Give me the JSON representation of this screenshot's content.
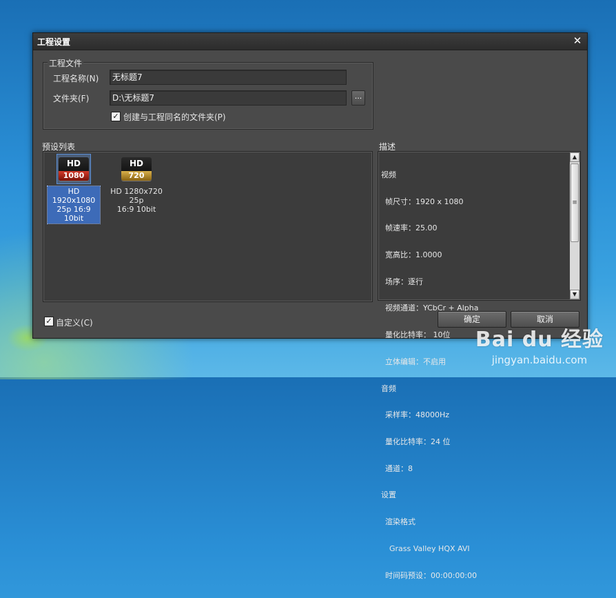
{
  "dialog": {
    "title": "工程设置",
    "close_glyph": "✕",
    "project_file_group": {
      "legend": "工程文件",
      "name_label": "工程名称(N)",
      "name_value": "无标题7",
      "folder_label": "文件夹(F)",
      "folder_value": "D:\\无标题7",
      "browse_label": "...",
      "create_folder_checkbox": {
        "checked": true,
        "label": "创建与工程同名的文件夹(P)"
      }
    },
    "preset_list": {
      "label": "预设列表",
      "presets": [
        {
          "icon": "hd-1080-icon",
          "badge_top": "HD",
          "badge_bottom": "1080",
          "caption_line1": "HD 1920x1080",
          "caption_line2": "25p 16:9 10bit",
          "selected": true
        },
        {
          "icon": "hd-720-icon",
          "badge_top": "HD",
          "badge_bottom": "720",
          "caption_line1": "HD 1280x720 25p",
          "caption_line2": "16:9 10bit",
          "selected": false
        }
      ]
    },
    "description": {
      "label": "描述",
      "lines": [
        {
          "text": "视频",
          "level": 0
        },
        {
          "text": "帧尺寸：1920 x 1080",
          "level": 1
        },
        {
          "text": "帧速率：25.00",
          "level": 1
        },
        {
          "text": "宽高比：1.0000",
          "level": 1
        },
        {
          "text": "场序：逐行",
          "level": 1
        },
        {
          "text": "视频通道：YCbCr + Alpha",
          "level": 1
        },
        {
          "text": "量化比特率： 10位",
          "level": 1
        },
        {
          "text": "立体编辑：不启用",
          "level": 1
        },
        {
          "text": "音频",
          "level": 0
        },
        {
          "text": "采样率：48000Hz",
          "level": 1
        },
        {
          "text": "量化比特率：24 位",
          "level": 1
        },
        {
          "text": "通道：8",
          "level": 1
        },
        {
          "text": "设置",
          "level": 0
        },
        {
          "text": "渲染格式",
          "level": 1
        },
        {
          "text": "Grass Valley HQX AVI",
          "level": 2
        },
        {
          "text": "时间码预设：00:00:00:00",
          "level": 1
        }
      ],
      "scroll_up": "▲",
      "scroll_down": "▼",
      "scroll_grip": "≡"
    },
    "custom_checkbox": {
      "checked": true,
      "label": "自定义(C)"
    },
    "ok_button": "确定",
    "cancel_button": "取消"
  },
  "watermark": {
    "logo": "Bai du 经验",
    "url": "jingyan.baidu.com"
  }
}
